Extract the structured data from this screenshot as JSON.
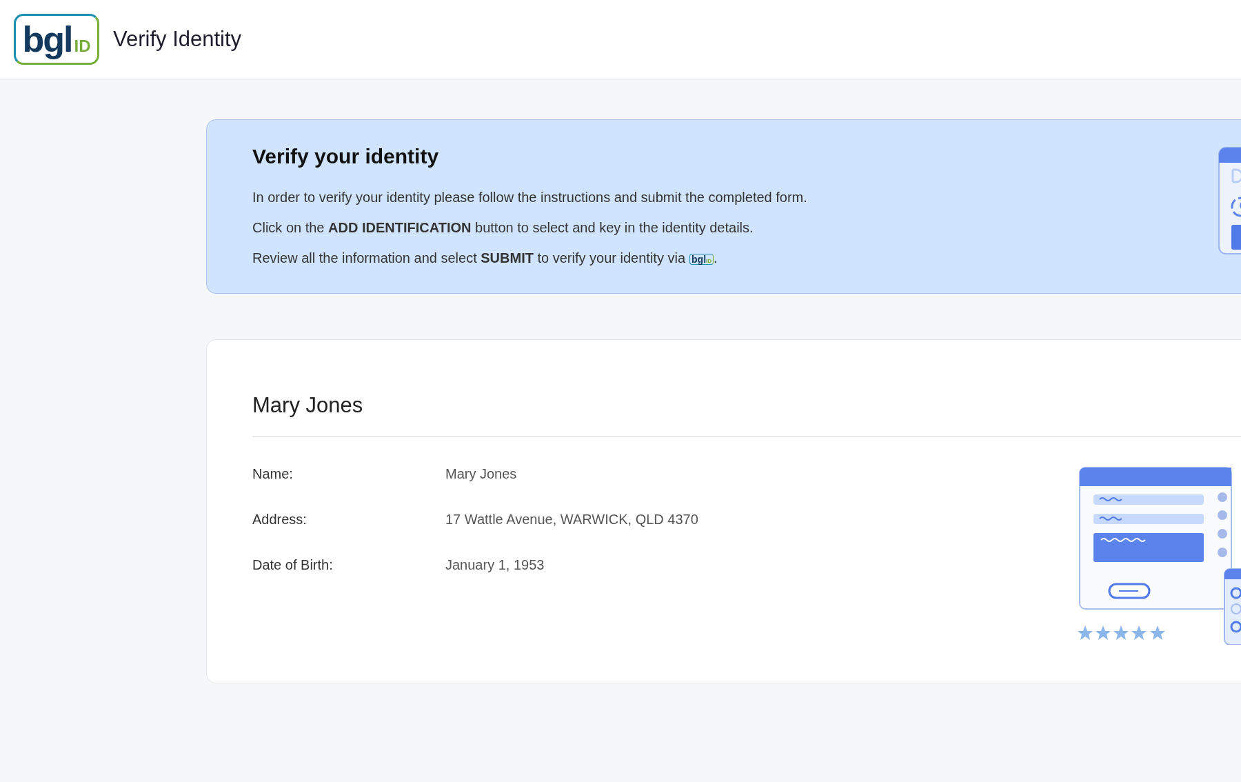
{
  "header": {
    "logo": {
      "main": "bgl",
      "suffix": "ID"
    },
    "title": "Verify Identity"
  },
  "banner": {
    "title": "Verify your identity",
    "lines": [
      {
        "text": "In order to verify your identity please follow the instructions and submit the completed form."
      },
      {
        "text": "Click on the **ADD IDENTIFICATION** button to select and key in the identity details."
      },
      {
        "text": "Review all the information and select **SUBMIT** to verify your identity via",
        "inline_logo": {
          "main": "bgl",
          "suffix": "ID"
        },
        "after": "."
      }
    ]
  },
  "profile": {
    "heading": "Mary Jones",
    "fields": [
      {
        "label": "Name:",
        "value": "Mary Jones"
      },
      {
        "label": "Address:",
        "value": "17 Wattle Avenue, WARWICK, QLD 4370"
      },
      {
        "label": "Date of Birth:",
        "value": "January 1, 1953"
      }
    ]
  }
}
